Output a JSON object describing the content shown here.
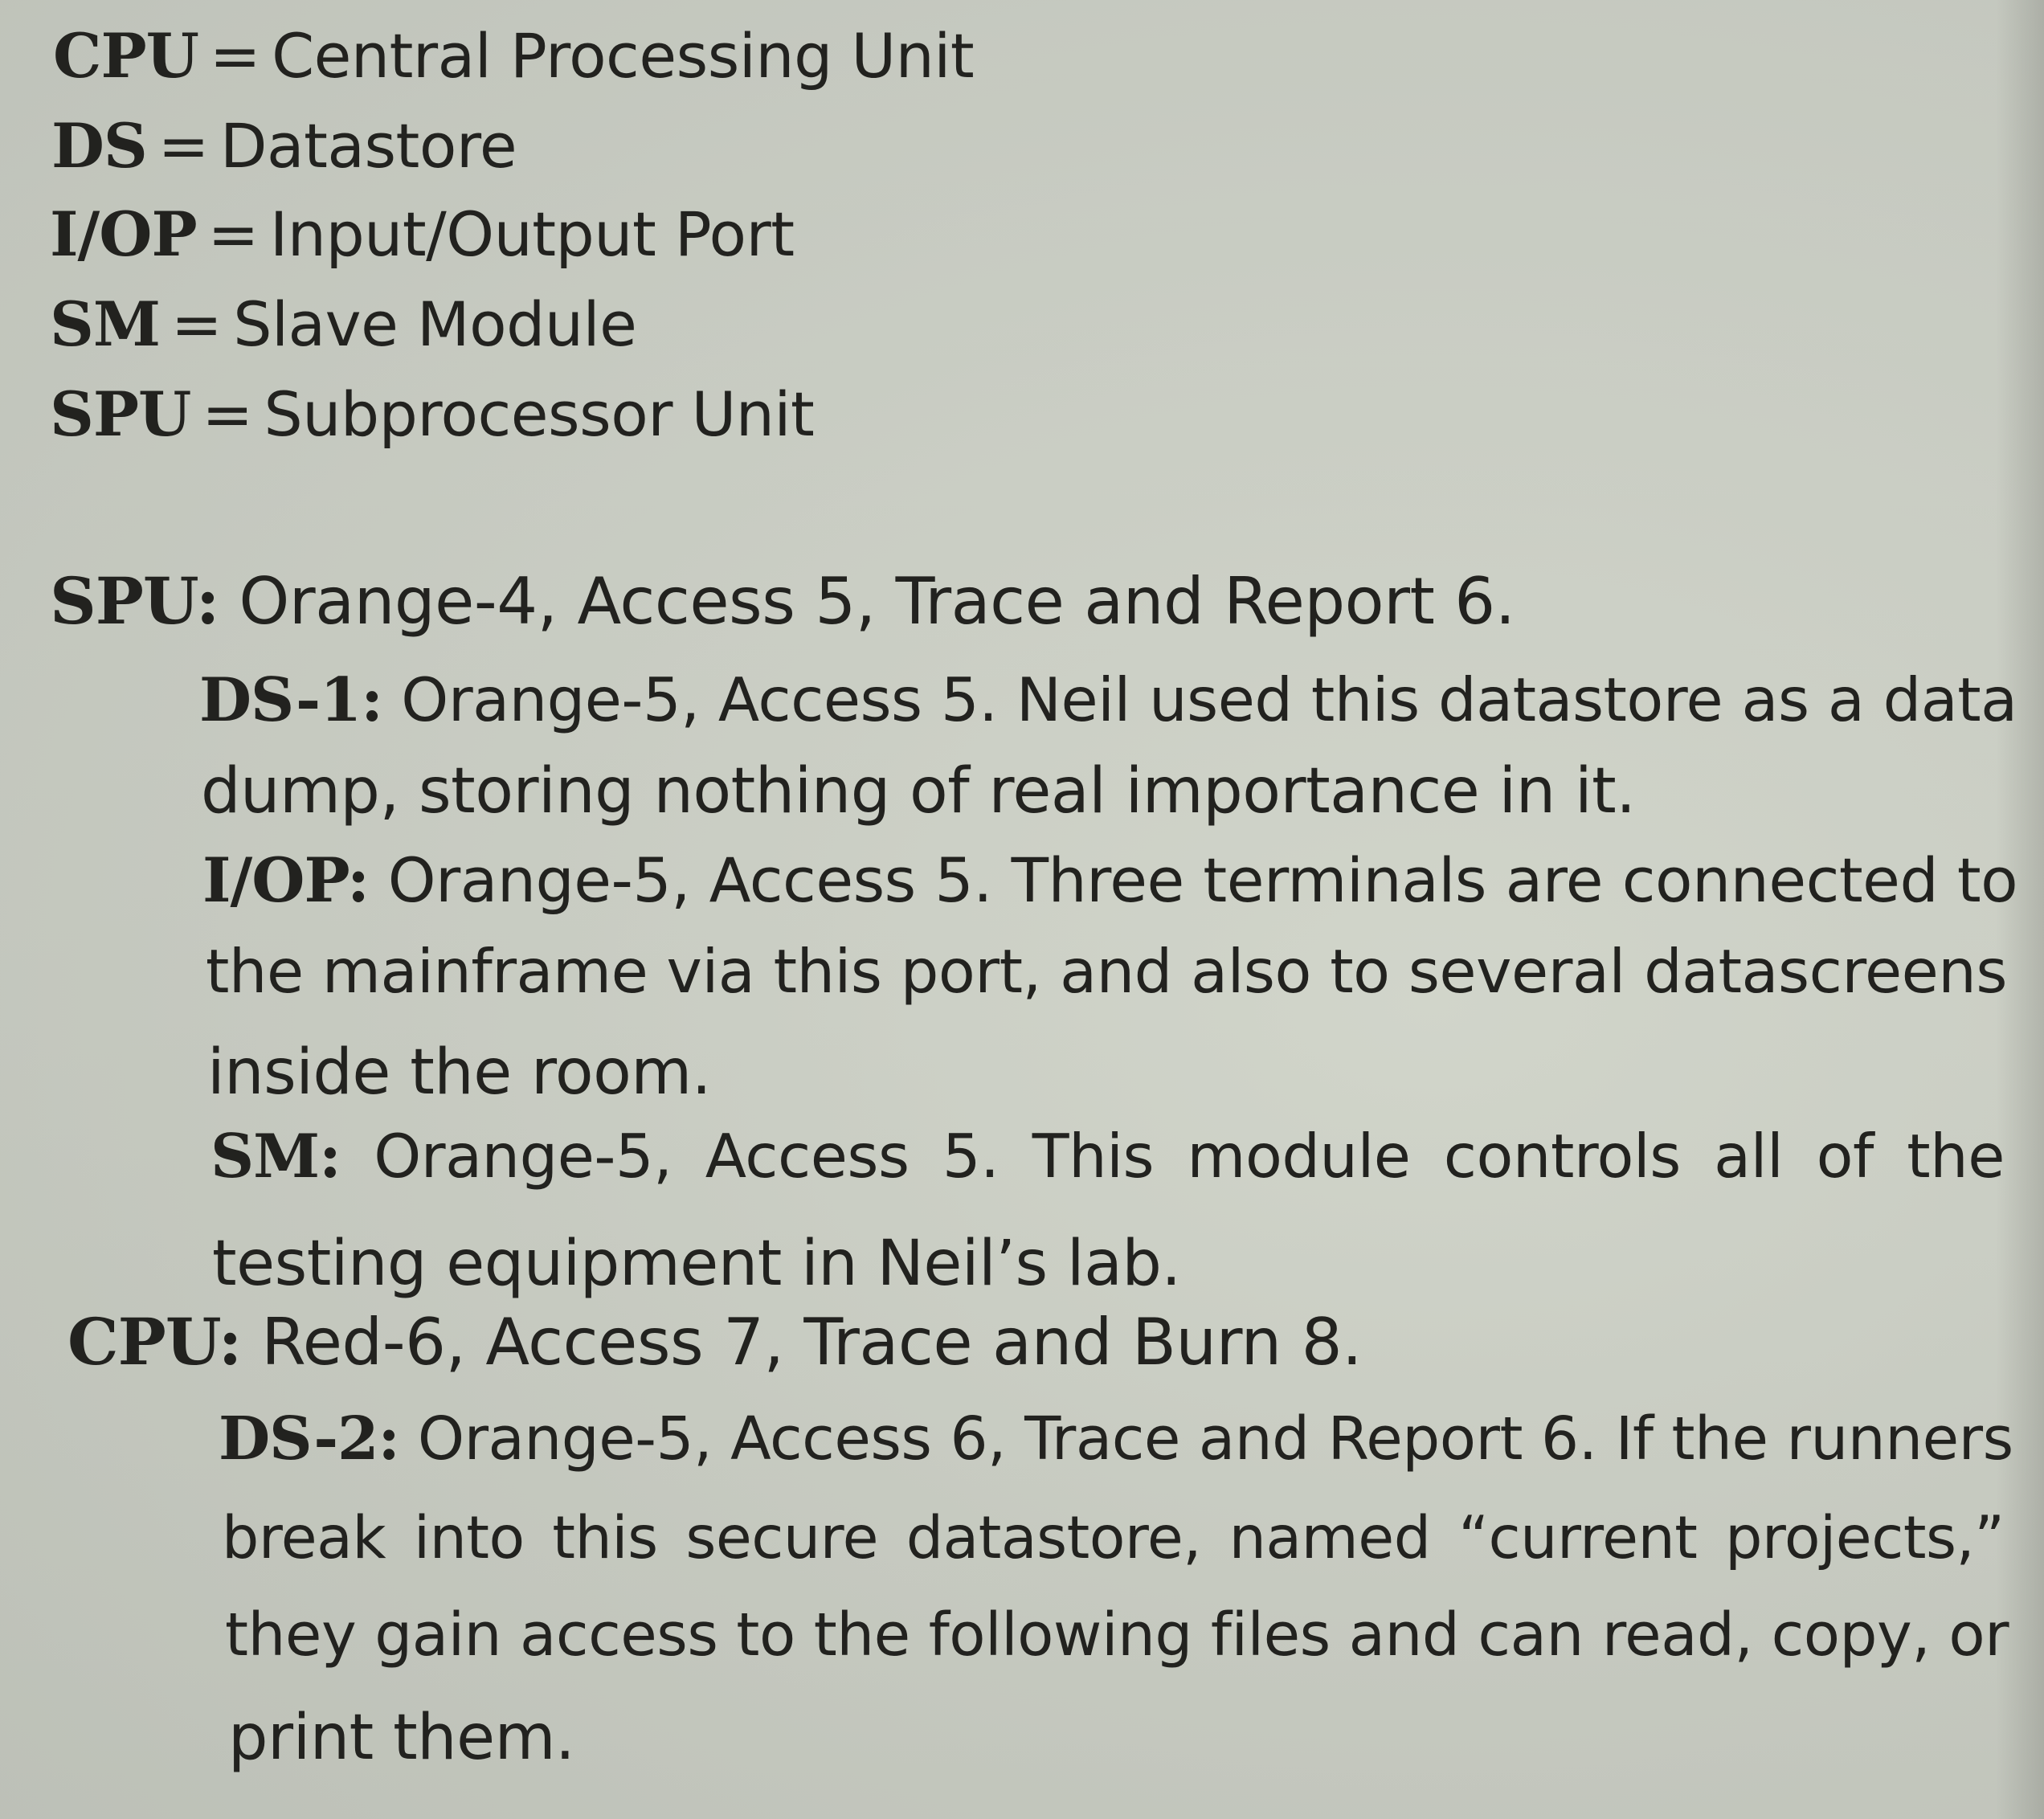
{
  "legend": [
    {
      "abbr": "CPU",
      "meaning": "Central Processing Unit"
    },
    {
      "abbr": "DS",
      "meaning": "Datastore"
    },
    {
      "abbr": "I/OP",
      "meaning": "Input/Output Port"
    },
    {
      "abbr": "SM",
      "meaning": "Slave Module"
    },
    {
      "abbr": "SPU",
      "meaning": "Subprocessor Unit"
    }
  ],
  "equals": "=",
  "entries": {
    "spu": {
      "label": "SPU:",
      "text": "Orange-4, Access 5, Trace and Report 6."
    },
    "ds1": {
      "label": "DS-1:",
      "line1": "Orange-5, Access 5. Neil used this datastore as a data",
      "line2": "dump, storing nothing of real importance in it."
    },
    "iop": {
      "label": "I/OP:",
      "line1": "Orange-5, Access 5. Three terminals are connected to",
      "line2": "the mainframe via this port, and also to several datascreens",
      "line3": "inside the room."
    },
    "sm": {
      "label": "SM:",
      "line1": "Orange-5, Access 5. This module controls all of the",
      "line2": "testing equipment in Neil’s lab."
    },
    "cpu": {
      "label": "CPU:",
      "text": "Red-6, Access 7, Trace and Burn 8."
    },
    "ds2": {
      "label": "DS-2:",
      "line1": "Orange-5, Access 6, Trace and Report 6. If the runners",
      "line2": "break into this secure datastore, named “current projects,”",
      "line3": "they gain access to the following files and can read, copy, or",
      "line4": "print them."
    }
  }
}
